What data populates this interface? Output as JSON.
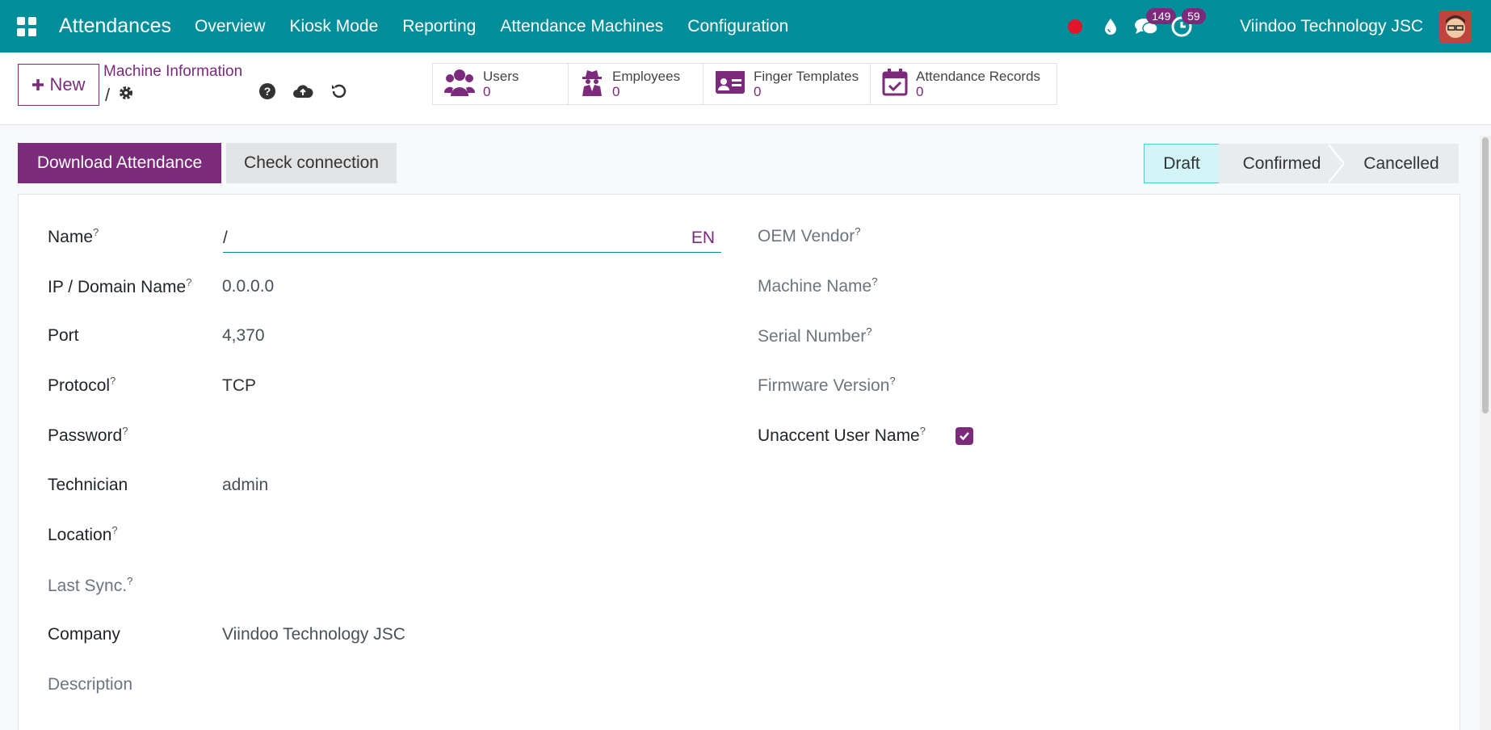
{
  "navbar": {
    "app_name": "Attendances",
    "menu": [
      "Overview",
      "Kiosk Mode",
      "Reporting",
      "Attendance Machines",
      "Configuration"
    ],
    "messages_count": "149",
    "activities_count": "59",
    "company": "Viindoo Technology JSC"
  },
  "control_panel": {
    "new_label": "New",
    "breadcrumb": "Machine Information",
    "record_name": "/",
    "smart_buttons": [
      {
        "label": "Users",
        "value": "0"
      },
      {
        "label": "Employees",
        "value": "0"
      },
      {
        "label": "Finger Templates",
        "value": "0"
      },
      {
        "label": "Attendance Records",
        "value": "0"
      }
    ]
  },
  "statusbar": {
    "download_label": "Download Attendance",
    "check_label": "Check connection",
    "stages": [
      "Draft",
      "Confirmed",
      "Cancelled"
    ],
    "active_stage": "Draft"
  },
  "form": {
    "name_label": "Name",
    "name_value": "/",
    "name_lang": "EN",
    "ip_label": "IP / Domain Name",
    "ip_value": "0.0.0.0",
    "port_label": "Port",
    "port_value": "4,370",
    "protocol_label": "Protocol",
    "protocol_value": "TCP",
    "password_label": "Password",
    "technician_label": "Technician",
    "technician_value": "admin",
    "location_label": "Location",
    "last_sync_label": "Last Sync.",
    "company_label": "Company",
    "company_value": "Viindoo Technology JSC",
    "description_label": "Description",
    "oem_label": "OEM Vendor",
    "machine_name_label": "Machine Name",
    "serial_label": "Serial Number",
    "firmware_label": "Firmware Version",
    "unaccent_label": "Unaccent User Name",
    "unaccent_checked": true,
    "help_mark": "?"
  },
  "colors": {
    "navbar": "#008f9a",
    "brand": "#7c2a7b",
    "active_stage": "#d2f4f7"
  }
}
